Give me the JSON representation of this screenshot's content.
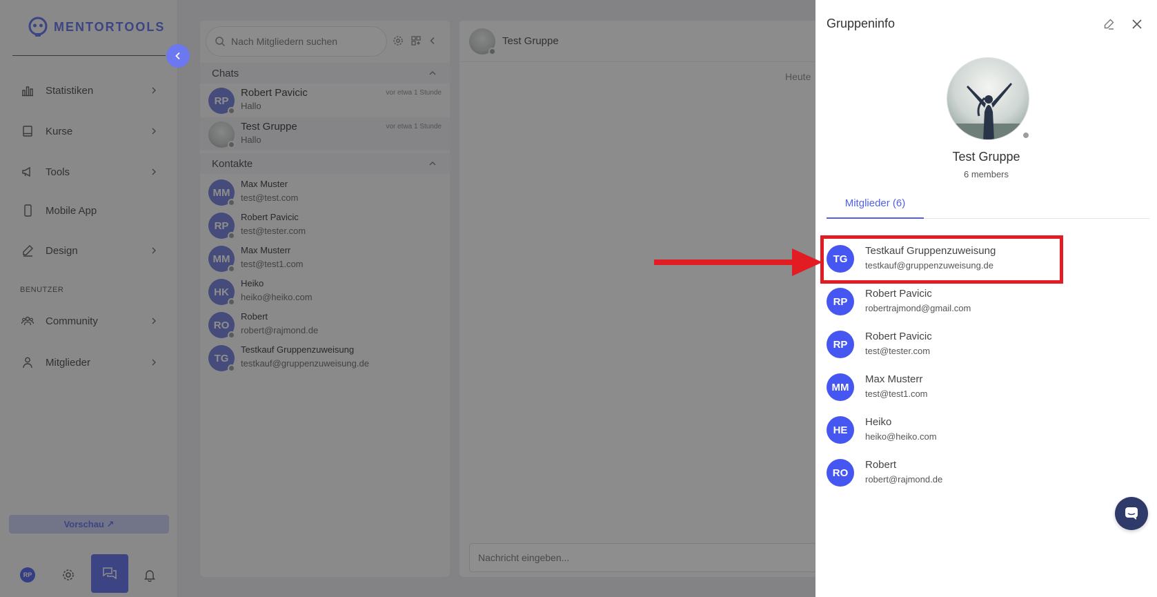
{
  "brand": {
    "name": "MENTORTOOLS"
  },
  "sidebar": {
    "items": [
      {
        "label": "Statistiken",
        "icon": "bar-chart-icon"
      },
      {
        "label": "Kurse",
        "icon": "book-icon"
      },
      {
        "label": "Tools",
        "icon": "megaphone-icon"
      },
      {
        "label": "Mobile App",
        "icon": "phone-icon"
      },
      {
        "label": "Design",
        "icon": "pencil-icon"
      },
      {
        "label": "Community",
        "icon": "people-icon"
      },
      {
        "label": "Mitglieder",
        "icon": "user-icon"
      }
    ],
    "section_label": "BENUTZER",
    "preview_label": "Vorschau ↗",
    "user_initials": "RP"
  },
  "chatlist": {
    "search_placeholder": "Nach Mitgliedern suchen",
    "chats_label": "Chats",
    "contacts_label": "Kontakte",
    "chats": [
      {
        "initials": "RP",
        "name": "Robert Pavicic",
        "preview": "Hallo",
        "time": "vor etwa 1 Stunde"
      },
      {
        "initials": "",
        "name": "Test Gruppe",
        "preview": "Hallo",
        "time": "vor etwa 1 Stunde"
      }
    ],
    "contacts": [
      {
        "initials": "MM",
        "name": "Max Muster",
        "email": "test@test.com"
      },
      {
        "initials": "RP",
        "name": "Robert Pavicic",
        "email": "test@tester.com"
      },
      {
        "initials": "MM",
        "name": "Max Musterr",
        "email": "test@test1.com"
      },
      {
        "initials": "HK",
        "name": "Heiko",
        "email": "heiko@heiko.com"
      },
      {
        "initials": "RO",
        "name": "Robert",
        "email": "robert@rajmond.de"
      },
      {
        "initials": "TG",
        "name": "Testkauf Gruppenzuweisung",
        "email": "testkauf@gruppenzuweisung.de"
      }
    ]
  },
  "conversation": {
    "title": "Test Gruppe",
    "date_label": "Heute",
    "input_placeholder": "Nachricht eingeben..."
  },
  "group_info": {
    "title": "Gruppeninfo",
    "name": "Test Gruppe",
    "member_count": "6 members",
    "tab_label": "Mitglieder (6)",
    "members": [
      {
        "initials": "TG",
        "name": "Testkauf Gruppenzuweisung",
        "email": "testkauf@gruppenzuweisung.de"
      },
      {
        "initials": "RP",
        "name": "Robert Pavicic",
        "email": "robertrajmond@gmail.com"
      },
      {
        "initials": "RP",
        "name": "Robert Pavicic",
        "email": "test@tester.com"
      },
      {
        "initials": "MM",
        "name": "Max Musterr",
        "email": "test@test1.com"
      },
      {
        "initials": "HE",
        "name": "Heiko",
        "email": "heiko@heiko.com"
      },
      {
        "initials": "RO",
        "name": "Robert",
        "email": "robert@rajmond.de"
      }
    ]
  },
  "colors": {
    "accent": "#4557f0",
    "highlight": "#e21c23",
    "help_bubble": "#2d3a6a"
  }
}
